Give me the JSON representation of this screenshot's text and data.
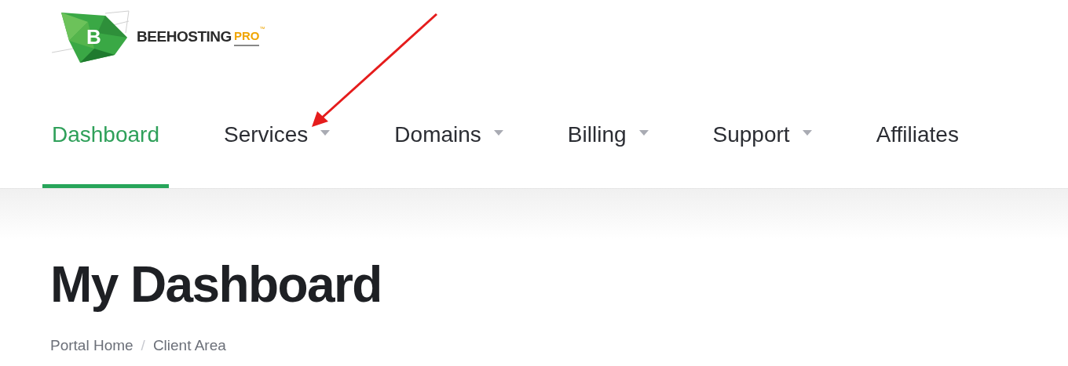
{
  "logo": {
    "letter": "B",
    "name": "BEEHOSTING",
    "suffix": "PRO",
    "tm": "™"
  },
  "nav": [
    {
      "label": "Dashboard",
      "selected": true,
      "dropdown": false
    },
    {
      "label": "Services",
      "selected": false,
      "dropdown": true
    },
    {
      "label": "Domains",
      "selected": false,
      "dropdown": true
    },
    {
      "label": "Billing",
      "selected": false,
      "dropdown": true
    },
    {
      "label": "Support",
      "selected": false,
      "dropdown": true
    },
    {
      "label": "Affiliates",
      "selected": false,
      "dropdown": false
    }
  ],
  "page_title": "My Dashboard",
  "breadcrumb": {
    "items": [
      "Portal Home",
      "Client Area"
    ],
    "separator": "/"
  }
}
